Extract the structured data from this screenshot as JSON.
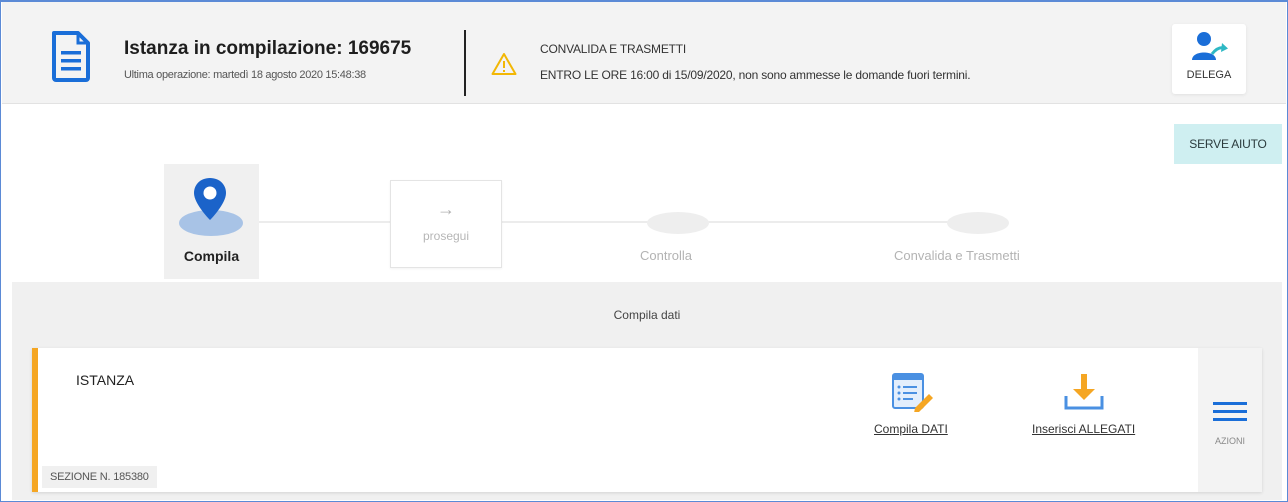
{
  "header": {
    "doc_icon": "document-icon",
    "title": "Istanza in compilazione: 169675",
    "subtitle": "Ultima operazione: martedì 18 agosto 2020 15:48:38",
    "warning_icon": "warning-triangle-icon",
    "warning_title": "CONVALIDA E TRASMETTI",
    "warning_text": "ENTRO LE ORE 16:00 di 15/09/2020, non sono ammesse le domande fuori termini.",
    "delega_icon": "user-delegate-icon",
    "delega_label": "DELEGA"
  },
  "help": {
    "label": "SERVE AIUTO"
  },
  "stepper": {
    "active_icon": "map-pin-icon",
    "steps": [
      "Compila",
      "Controlla",
      "Convalida e Trasmetti"
    ],
    "next_arrow": "→",
    "next_label": "prosegui"
  },
  "section": {
    "title": "Compila dati",
    "card": {
      "title": "ISTANZA",
      "sezione": "SEZIONE N. 185380",
      "actions": [
        {
          "label": "Compila DATI",
          "icon": "edit-form-icon"
        },
        {
          "label": "Inserisci ALLEGATI",
          "icon": "download-tray-icon"
        }
      ],
      "azioni_label": "AZIONI",
      "azioni_icon": "hamburger-menu-icon"
    }
  },
  "colors": {
    "accent_blue": "#1a6ed8",
    "card_border": "#f5a623",
    "help_bg": "#cfeff1",
    "warning": "#f2b705"
  }
}
